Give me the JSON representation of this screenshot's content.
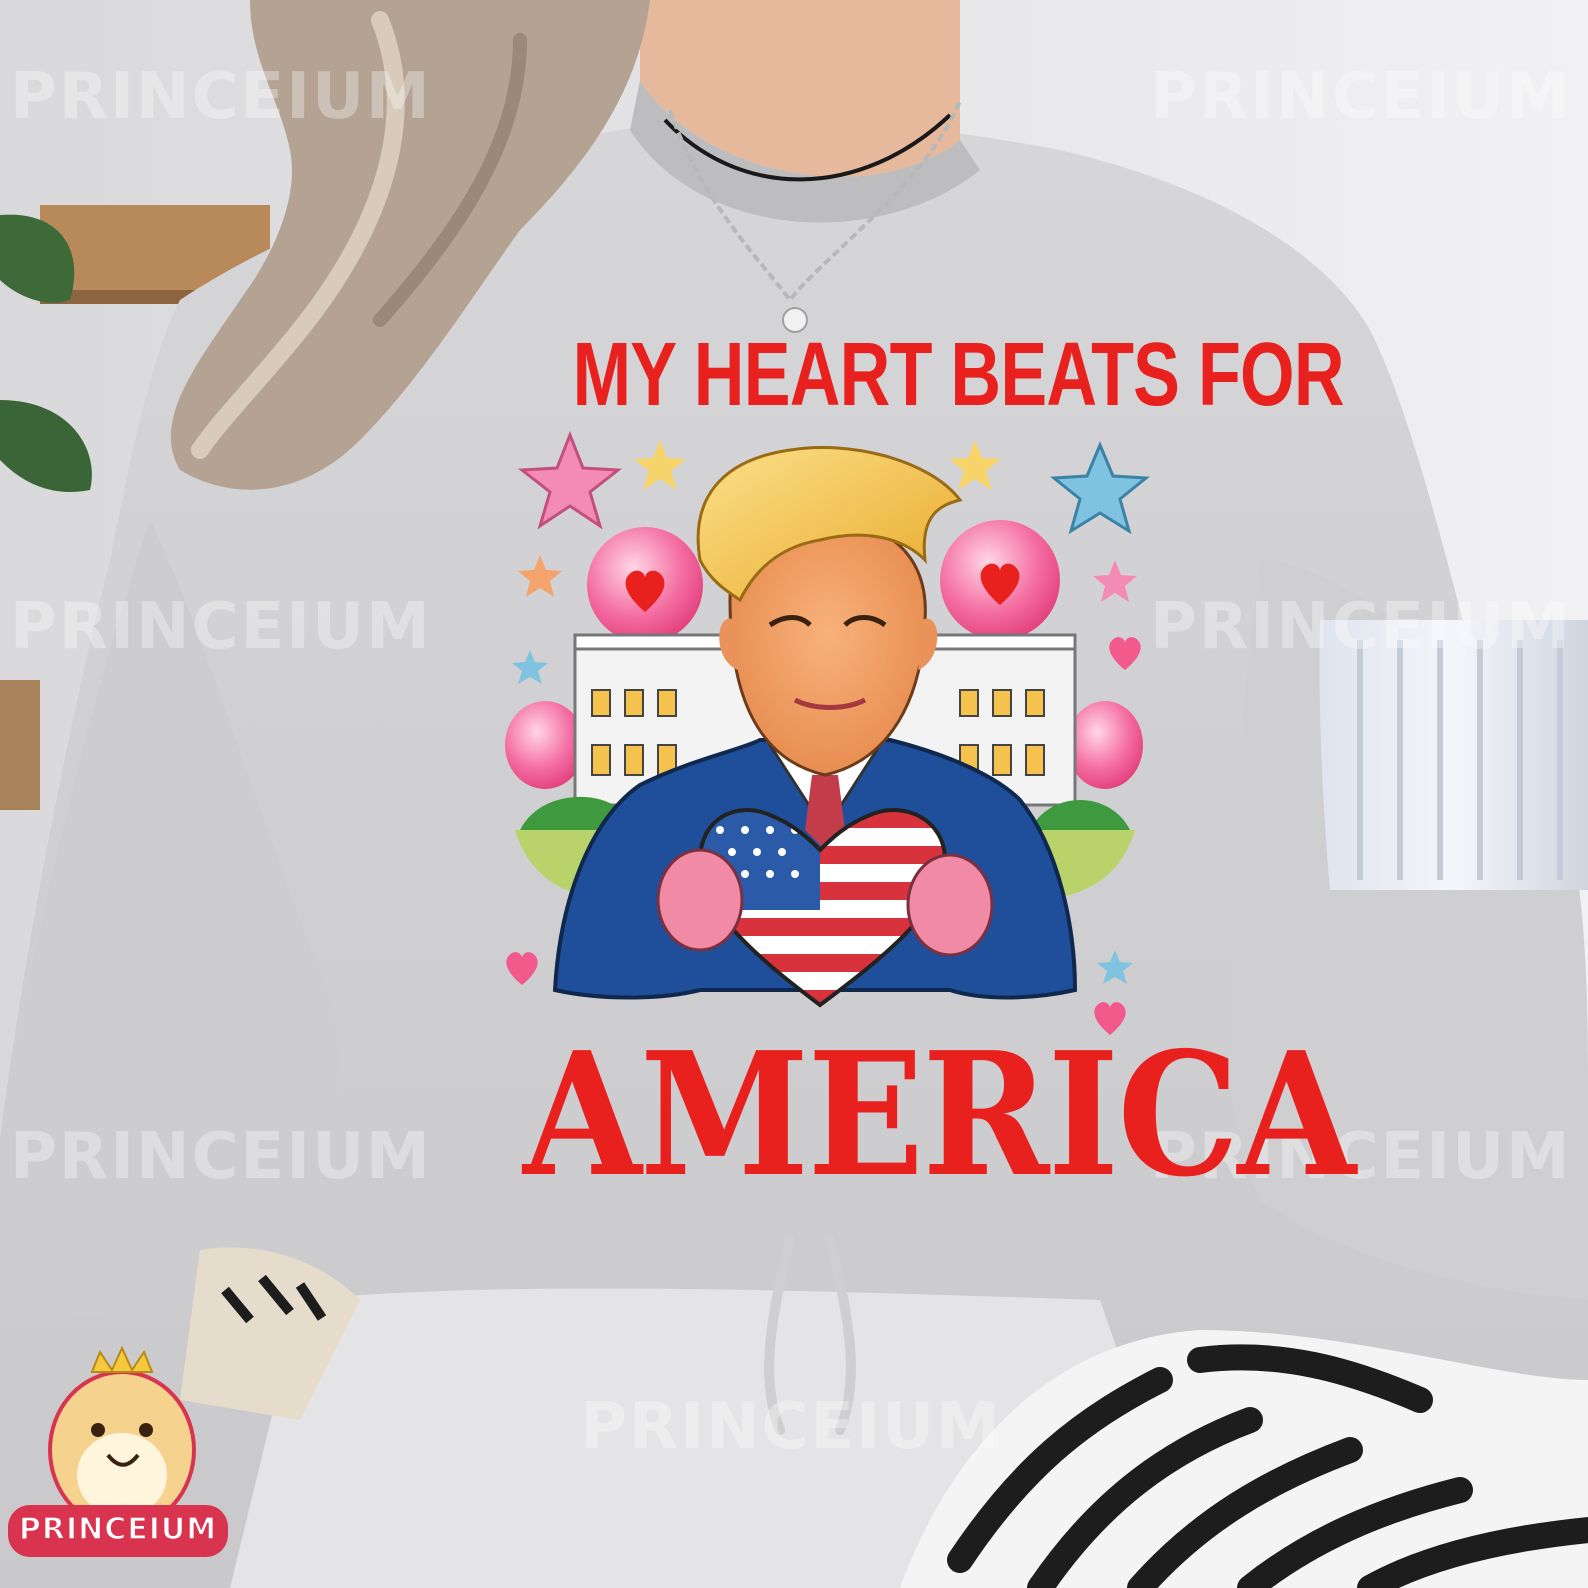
{
  "shirt_text": {
    "headline": "MY HEART BEATS FOR",
    "main_word": "AMERICA"
  },
  "watermark": {
    "text": "PRINCEIUM"
  },
  "logo": {
    "text": "PRINCEIUM"
  },
  "colors": {
    "shirt_text_red": "#e8211f",
    "sweater_gray": "#d3d3d5",
    "suit_blue": "#1f4f9a",
    "hair_blonde": "#f2c23e",
    "balloon_pink": "#f04f8c",
    "logo_pink": "#d9344f"
  }
}
